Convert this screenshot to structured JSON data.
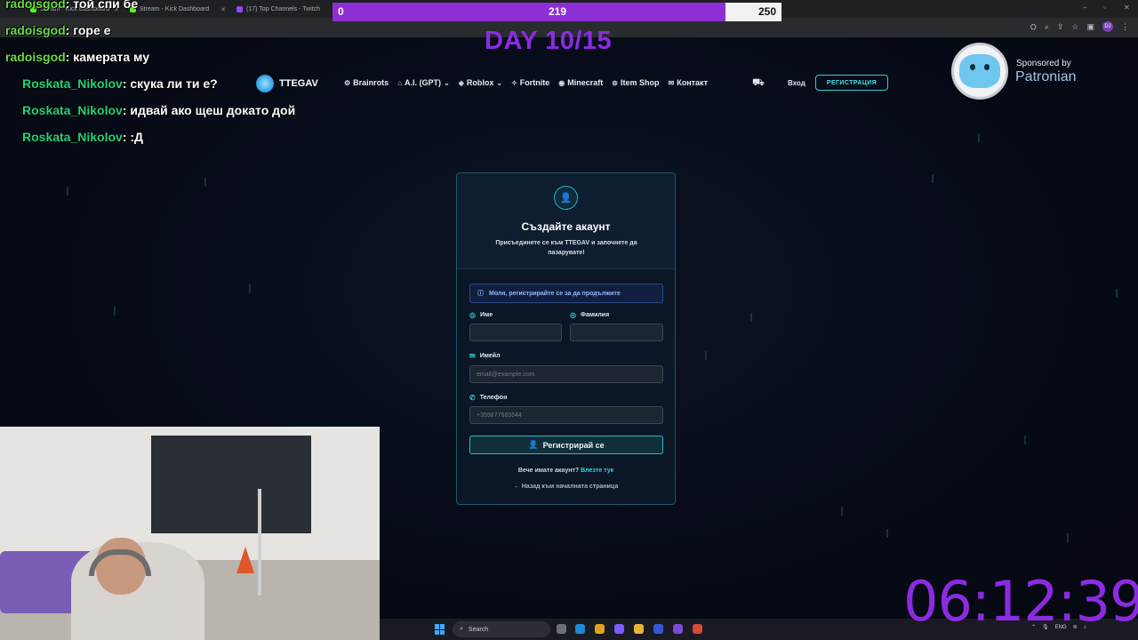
{
  "browser": {
    "tabs": [
      {
        "title": "Stream · Kick Dashboard",
        "color": "#53fc18"
      },
      {
        "title": "Stream - Kick Dashboard",
        "color": "#53fc18"
      },
      {
        "title": "(17) Top Channels - Twitch",
        "color": "#9146ff"
      }
    ]
  },
  "overlay": {
    "goal_start": "0",
    "goal_current": "219",
    "goal_target": "250",
    "goal_progress": 0.876,
    "day_label": "DAY 10/15",
    "timer": "06:12:39",
    "sponsor_by": "Sponsored by",
    "sponsor_name": "Patronian"
  },
  "chat": [
    {
      "user": "radoisgod",
      "text": ": той спи бе"
    },
    {
      "user": "radoisgod",
      "text": ": горе е"
    },
    {
      "user": "radoisgod",
      "text": ": камерата му"
    },
    {
      "user": "Roskata_Nikolov",
      "text": ": скука ли ти е?"
    },
    {
      "user": "Roskata_Nikolov",
      "text": ": идвай ако щеш докато дой"
    },
    {
      "user": "Roskata_Nikolov",
      "text": ": :Д"
    }
  ],
  "site": {
    "brand": "TTEGAV",
    "nav": [
      {
        "label": "Brainrots",
        "icon": "⚙"
      },
      {
        "label": "A.I. (GPT)",
        "icon": "⌂"
      },
      {
        "label": "Roblox",
        "icon": "◈"
      },
      {
        "label": "Fortnite",
        "icon": "✧"
      },
      {
        "label": "Minecraft",
        "icon": "◉"
      },
      {
        "label": "Item Shop",
        "icon": "⊜"
      },
      {
        "label": "Контакт",
        "icon": "✉"
      }
    ],
    "login": "Вход",
    "register": "РЕГИСТРАЦИЯ"
  },
  "form": {
    "title": "Създайте акаунт",
    "subtitle": "Присъединете се към TTEGAV и започнете да пазарувате!",
    "alert": "Моля, регистрирайте се за да продължите",
    "first_name_label": "Име",
    "last_name_label": "Фамилия",
    "email_label": "Имейл",
    "email_placeholder": "email@example.com",
    "phone_label": "Телефон",
    "phone_placeholder": "+359877665544",
    "submit": "Регистрирай се",
    "have_account": "Вече имате акаунт?",
    "login_link": "Влезте тук",
    "back": "Назад към началната страница"
  },
  "taskbar": {
    "search": "Search",
    "lang": "ENG"
  }
}
